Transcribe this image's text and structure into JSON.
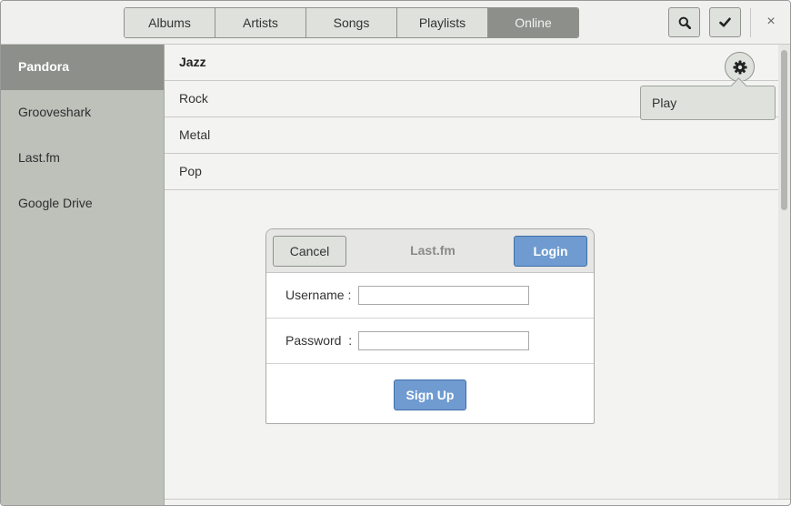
{
  "header": {
    "tabs": [
      {
        "label": "Albums"
      },
      {
        "label": "Artists"
      },
      {
        "label": "Songs"
      },
      {
        "label": "Playlists"
      },
      {
        "label": "Online",
        "active": true
      }
    ],
    "search_icon": "search-icon",
    "check_icon": "check-icon",
    "close_glyph": "×"
  },
  "sidebar": {
    "items": [
      {
        "label": "Pandora",
        "active": true
      },
      {
        "label": "Grooveshark"
      },
      {
        "label": "Last.fm"
      },
      {
        "label": "Google Drive"
      }
    ]
  },
  "main": {
    "genres": [
      {
        "label": "Jazz",
        "selected": true
      },
      {
        "label": "Rock"
      },
      {
        "label": "Metal"
      },
      {
        "label": "Pop"
      }
    ],
    "popover": {
      "label": "Play"
    }
  },
  "dialog": {
    "title": "Last.fm",
    "cancel_label": "Cancel",
    "login_label": "Login",
    "username_label": "Username :",
    "username_value": "",
    "password_label": "Password  :",
    "password_value": "",
    "signup_label": "Sign Up"
  },
  "colors": {
    "accent_blue": "#6f9bd1",
    "active_gray": "#8d908a",
    "sidebar_bg": "#bec0ba"
  }
}
